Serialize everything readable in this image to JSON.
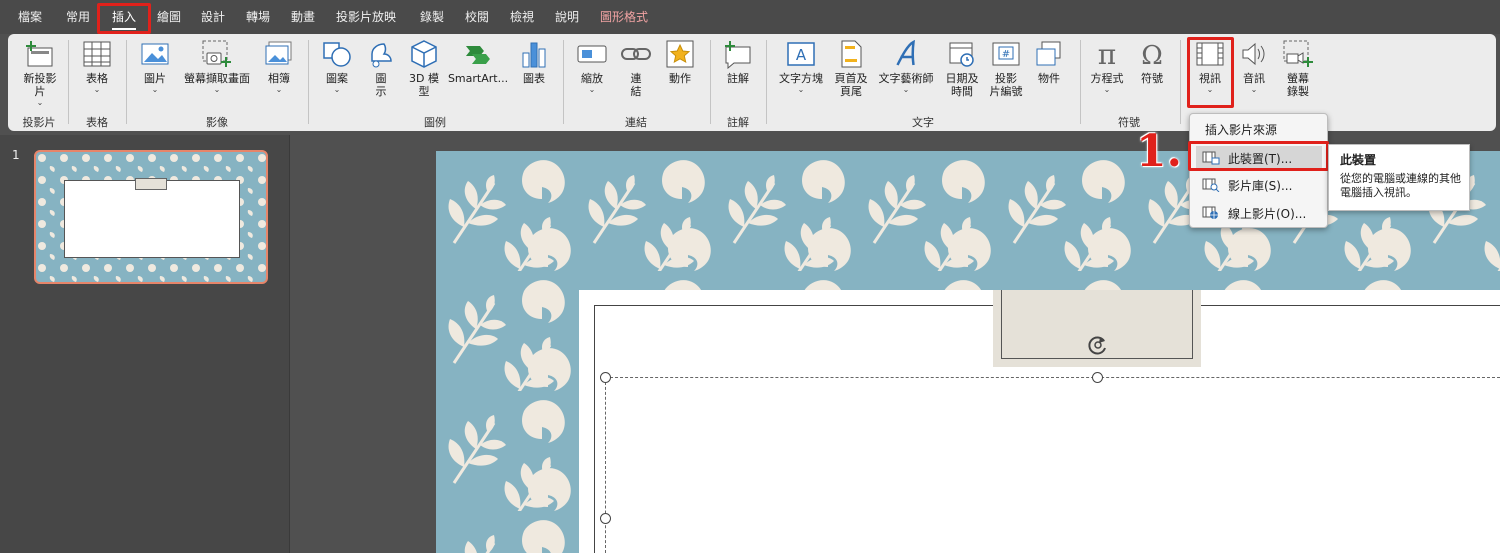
{
  "menu": {
    "items": [
      {
        "label": "檔案"
      },
      {
        "label": "常用"
      },
      {
        "label": "插入"
      },
      {
        "label": "繪圖"
      },
      {
        "label": "設計"
      },
      {
        "label": "轉場"
      },
      {
        "label": "動畫"
      },
      {
        "label": "投影片放映"
      },
      {
        "label": "錄製"
      },
      {
        "label": "校閱"
      },
      {
        "label": "檢視"
      },
      {
        "label": "說明"
      },
      {
        "label": "圖形格式"
      }
    ]
  },
  "ribbon": {
    "groups": {
      "slides": "投影片",
      "tables": "表格",
      "images": "影像",
      "illustrations": "圖例",
      "links": "連結",
      "comments": "註解",
      "text": "文字",
      "symbols": "符號"
    },
    "buttons": {
      "new_slide": "新投影\n片",
      "table": "表格",
      "pictures": "圖片",
      "screenshot": "螢幕擷取畫面",
      "album": "相簿",
      "shapes": "圖案",
      "icons": "圖\n示",
      "models3d": "3D 模\n型",
      "smartart": "SmartArt...",
      "chart": "圖表",
      "zoom": "縮放",
      "link": "連\n結",
      "action": "動作",
      "comment": "註解",
      "textbox": "文字方塊",
      "header_footer": "頁首及\n頁尾",
      "wordart": "文字藝術師",
      "datetime": "日期及\n時間",
      "slide_number": "投影\n片編號",
      "object": "物件",
      "equation": "方程式",
      "symbol": "符號",
      "video": "視訊",
      "audio": "音訊",
      "screen_recording": "螢幕\n錄製"
    }
  },
  "slides_panel": {
    "slide_number": "1"
  },
  "video_menu": {
    "header": "插入影片來源",
    "items": [
      {
        "label": "此裝置(T)..."
      },
      {
        "label": "影片庫(S)..."
      },
      {
        "label": "線上影片(O)..."
      }
    ]
  },
  "tooltip": {
    "title": "此裝置",
    "body": "從您的電腦或連線的其他電腦插入視訊。"
  },
  "annotation": {
    "step": "1."
  },
  "colors": {
    "highlight": "#e0211b",
    "pattern_bg": "#86b3c2",
    "pattern_leaf": "#efe9df"
  }
}
